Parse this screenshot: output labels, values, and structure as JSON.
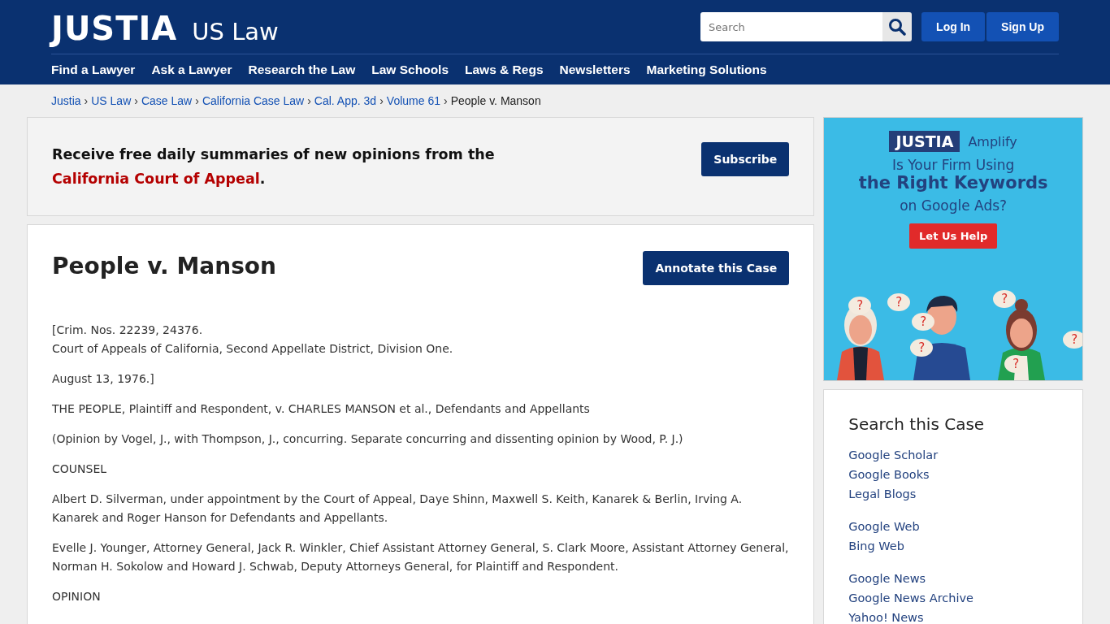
{
  "header": {
    "logo": "JUSTIA",
    "section": "US Law",
    "search": {
      "placeholder": "Search"
    },
    "buttons": [
      "Log In",
      "Sign Up"
    ]
  },
  "nav": [
    "Find a Lawyer",
    "Ask a Lawyer",
    "Research the Law",
    "Law Schools",
    "Laws & Regs",
    "Newsletters",
    "Marketing Solutions"
  ],
  "breadcrumbs": [
    "Justia",
    "US Law",
    "Case Law",
    "California Case Law",
    "Cal. App. 3d",
    "Volume 61"
  ],
  "breadcrumb_current": "People v. Manson",
  "breadcrumb_separator": "›",
  "subscribe": {
    "text": "Receive free daily summaries of new opinions from the ",
    "link": "California Court of Appeal",
    "end": ".",
    "button": "Subscribe"
  },
  "case": {
    "title": "People v. Manson",
    "button": "Annotate this Case",
    "paragraphs": [
      [
        "[Crim. Nos. 22239, 24376.",
        "Court of Appeals of California, Second Appellate District, Division One."
      ],
      [
        "August 13, 1976.]"
      ],
      [
        "THE PEOPLE, Plaintiff and Respondent, v. CHARLES MANSON et al., Defendants and Appellants"
      ],
      [
        "(Opinion by Vogel, J., with Thompson, J., concurring. Separate concurring and dissenting opinion by Wood, P. J.)"
      ],
      [
        "COUNSEL"
      ],
      [
        "Albert D. Silverman, under appointment by the Court of Appeal, Daye Shinn, Maxwell S. Keith, Kanarek & Berlin, Irving A. Kanarek and Roger Hanson for Defendants and Appellants."
      ],
      [
        "Evelle J. Younger, Attorney General, Jack R. Winkler, Chief Assistant Attorney General, S. Clark Moore, Assistant Attorney General, Norman H. Sokolow and Howard J. Schwab, Deputy Attorneys General, for Plaintiff and Respondent."
      ],
      [
        "OPINION"
      ]
    ]
  },
  "ad": {
    "logo": "JUSTIA",
    "brand": "Amplify",
    "line1": "Is Your Firm Using",
    "line2": "the Right Keywords",
    "line3": "on Google Ads?",
    "button": "Let Us Help",
    "marks": [
      "?",
      "?",
      "?",
      "?",
      "?",
      "?",
      "?"
    ]
  },
  "search_case": {
    "title": "Search this Case",
    "groups": [
      [
        "Google Scholar",
        "Google Books",
        "Legal Blogs"
      ],
      [
        "Google Web",
        "Bing Web"
      ],
      [
        "Google News",
        "Google News Archive",
        "Yahoo! News"
      ]
    ]
  }
}
